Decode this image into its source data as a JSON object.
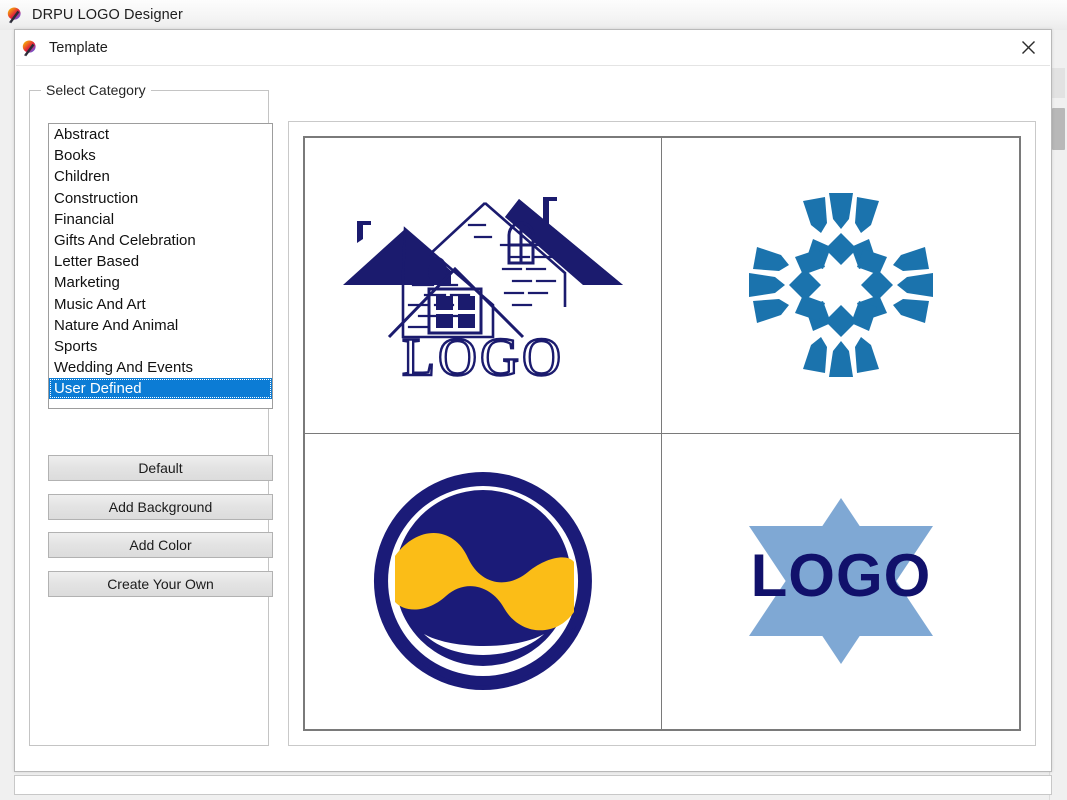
{
  "app": {
    "title": "DRPU LOGO Designer",
    "icon": "logo-designer-app-icon"
  },
  "dialog": {
    "title": "Template",
    "icon": "logo-designer-app-icon",
    "close_label": "✕"
  },
  "sidebar": {
    "group_label": "Select Category",
    "categories": [
      {
        "label": "Abstract",
        "selected": false
      },
      {
        "label": "Books",
        "selected": false
      },
      {
        "label": "Children",
        "selected": false
      },
      {
        "label": "Construction",
        "selected": false
      },
      {
        "label": "Financial",
        "selected": false
      },
      {
        "label": "Gifts And Celebration",
        "selected": false
      },
      {
        "label": "Letter Based",
        "selected": false
      },
      {
        "label": "Marketing",
        "selected": false
      },
      {
        "label": "Music And Art",
        "selected": false
      },
      {
        "label": "Nature And Animal",
        "selected": false
      },
      {
        "label": "Sports",
        "selected": false
      },
      {
        "label": "Wedding And Events",
        "selected": false
      },
      {
        "label": "User Defined",
        "selected": true
      }
    ],
    "selected_category": "User Defined",
    "buttons": {
      "default": "Default",
      "add_background": "Add Background",
      "add_color": "Add Color",
      "create_your_own": "Create Your Own"
    }
  },
  "templates": {
    "count": 4,
    "items": [
      {
        "id": "template-house-logo",
        "art": "house-roofs-with-logo-text",
        "text": "LOGO",
        "colors": {
          "primary": "#1b1b6e"
        }
      },
      {
        "id": "template-geometric-snowflake",
        "art": "geometric-snowflake-mandala",
        "text": "",
        "colors": {
          "primary": "#1b73ad"
        }
      },
      {
        "id": "template-circle-wave",
        "art": "navy-circle-with-yellow-wave",
        "text": "",
        "colors": {
          "primary": "#1b1b78",
          "accent": "#fbbd17"
        }
      },
      {
        "id": "template-star-logo",
        "art": "six-point-star-with-logo-text",
        "text": "LOGO",
        "colors": {
          "primary": "#7fa8d4",
          "accent": "#11116b"
        }
      }
    ]
  },
  "theme": {
    "selection_blue": "#0c7cd5",
    "navy": "#1b1b6e",
    "mid_blue": "#1b73ad",
    "light_blue": "#7fa8d4",
    "gold": "#fbbd17",
    "window_bg": "#ffffff",
    "chrome_bg": "#f0f0f0"
  }
}
